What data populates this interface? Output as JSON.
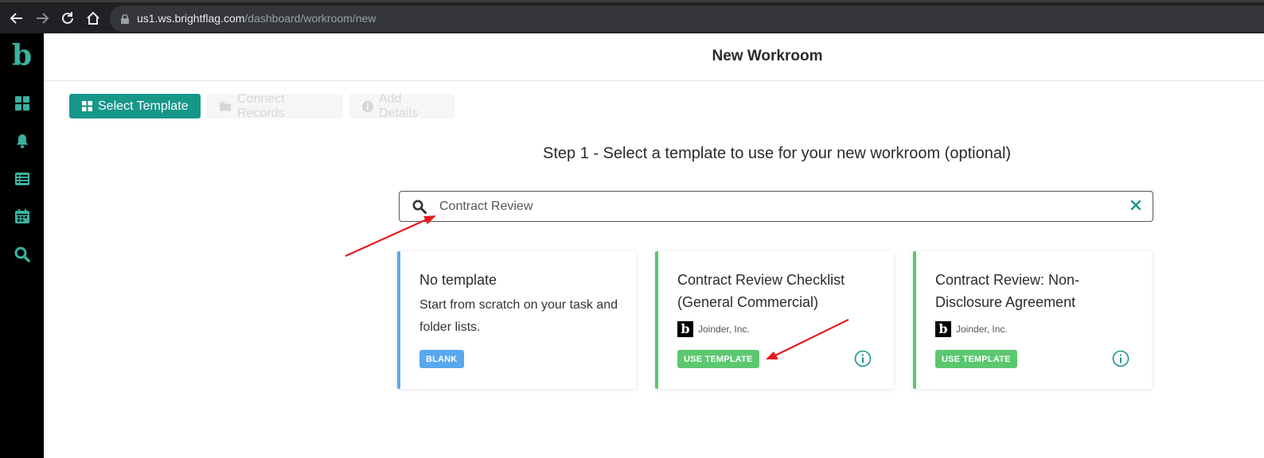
{
  "browser": {
    "url_domain": "us1.ws.brightflag.com",
    "url_path": "/dashboard/workroom/new"
  },
  "sidebar": {
    "logo": "b",
    "items": [
      {
        "icon": "dashboard-grid-icon"
      },
      {
        "icon": "bell-icon"
      },
      {
        "icon": "list-icon"
      },
      {
        "icon": "calendar-icon"
      },
      {
        "icon": "search-icon"
      }
    ]
  },
  "header": {
    "title": "New Workroom"
  },
  "steps": [
    {
      "label": "Select Template",
      "icon": "grid-icon",
      "active": true
    },
    {
      "label": "Connect Records",
      "icon": "folder-icon",
      "active": false
    },
    {
      "label": "Add Details",
      "icon": "info-icon",
      "active": false
    }
  ],
  "step_title": "Step 1 - Select a template to use for your new workroom (optional)",
  "search": {
    "value": "Contract Review"
  },
  "cards": [
    {
      "title": "No template",
      "description": "Start from scratch on your task and folder lists.",
      "badge": "BLANK"
    },
    {
      "title": "Contract Review Checklist (General Commercial)",
      "org": "Joinder, Inc.",
      "org_logo": "b",
      "badge": "USE TEMPLATE"
    },
    {
      "title": "Contract Review: Non-Disclosure Agreement",
      "org": "Joinder, Inc.",
      "org_logo": "b",
      "badge": "USE TEMPLATE"
    }
  ],
  "colors": {
    "accent": "#17968a",
    "blue": "#5aa7ee",
    "green": "#5cc770",
    "sidebar": "#000000",
    "annotation": "#e8191f"
  }
}
